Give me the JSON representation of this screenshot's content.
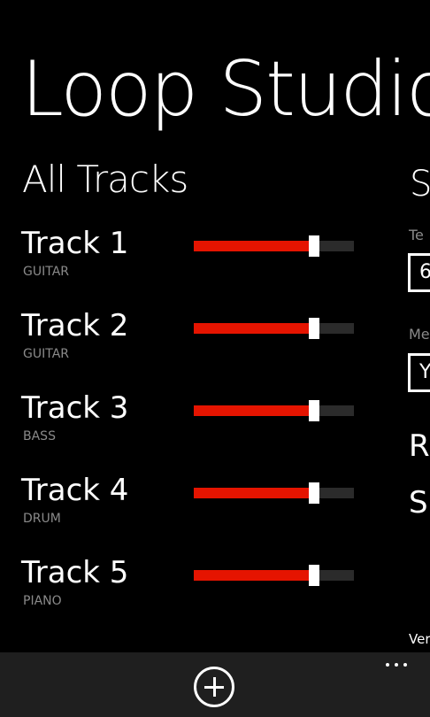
{
  "app": {
    "title": "Loop Studio"
  },
  "panorama": {
    "section_title": "All Tracks",
    "tracks": [
      {
        "name": "Track 1",
        "type": "GUITAR",
        "volume": 0.74
      },
      {
        "name": "Track 2",
        "type": "GUITAR",
        "volume": 0.74
      },
      {
        "name": "Track 3",
        "type": "BASS",
        "volume": 0.74
      },
      {
        "name": "Track 4",
        "type": "DRUM",
        "volume": 0.74
      },
      {
        "name": "Track 5",
        "type": "PIANO",
        "volume": 0.74
      }
    ],
    "next_section": {
      "title": "S",
      "field1_label": "Te",
      "field1_value": "6",
      "field2_label": "Me",
      "field2_value": "Y",
      "item1": "R",
      "item2": "S",
      "version": "Ver"
    }
  },
  "app_bar": {
    "more_label": "..."
  },
  "colors": {
    "accent": "#e51400",
    "track_background": "#2b2b2b",
    "app_bar": "#1f1f1f"
  },
  "icons": {
    "add": "add-circle-icon",
    "more": "more-ellipsis-icon"
  }
}
